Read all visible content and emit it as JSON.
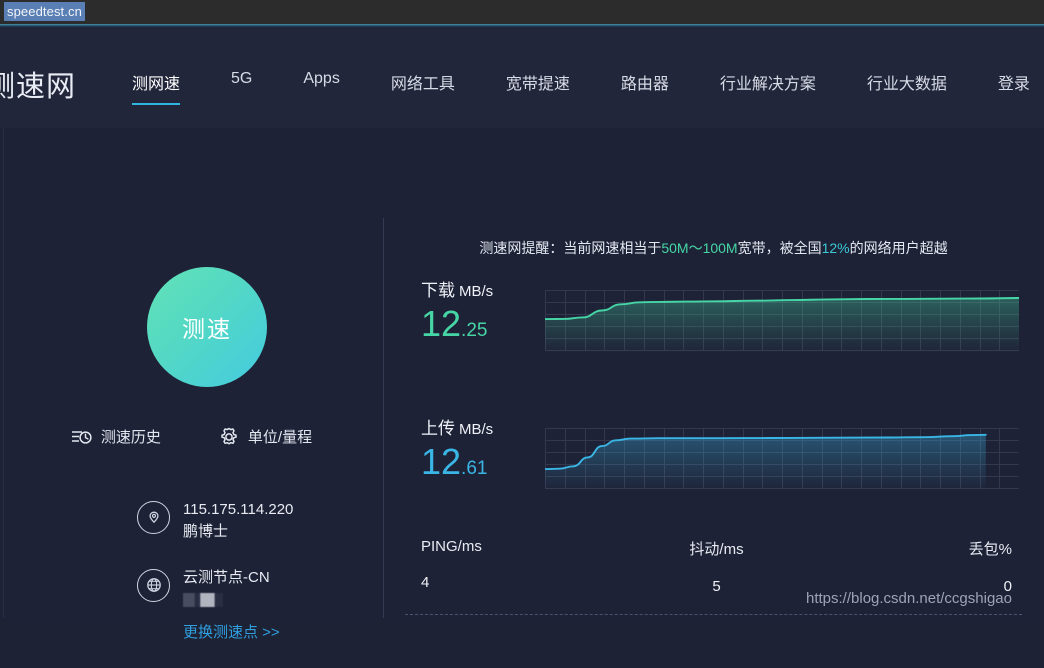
{
  "browser": {
    "url": "speedtest.cn"
  },
  "header": {
    "logo": "测速网",
    "nav": [
      {
        "label": "测网速",
        "active": true
      },
      {
        "label": "5G",
        "active": false
      },
      {
        "label": "Apps",
        "active": false
      },
      {
        "label": "网络工具",
        "active": false
      },
      {
        "label": "宽带提速",
        "active": false
      },
      {
        "label": "路由器",
        "active": false
      },
      {
        "label": "行业解决方案",
        "active": false
      },
      {
        "label": "行业大数据",
        "active": false
      },
      {
        "label": "登录",
        "active": false
      }
    ]
  },
  "left_panel": {
    "start_button_label": "测速",
    "actions": [
      {
        "label": "测速历史",
        "icon": "history-icon"
      },
      {
        "label": "单位/量程",
        "icon": "gear-icon"
      }
    ],
    "ip_info": {
      "icon": "location-pin-icon",
      "ip": "115.175.114.220",
      "isp": "鹏博士"
    },
    "server_info": {
      "icon": "globe-icon",
      "node": "云测节点-CN",
      "detail_masked": "",
      "change_link": "更换测速点 >>"
    }
  },
  "right_panel": {
    "notice": {
      "prefix": "测速网提醒：当前网速相当于",
      "bandwidth": "50M～100M",
      "middle": "宽带，被全国",
      "percent": "12%",
      "suffix": "的网络用户超越"
    },
    "download": {
      "caption": "下载",
      "unit": "MB/s",
      "value_int": "12",
      "value_frac": ".25",
      "color": "#46d6a6"
    },
    "upload": {
      "caption": "上传",
      "unit": "MB/s",
      "value_int": "12",
      "value_frac": ".61",
      "color": "#3ab6e6"
    },
    "stats": [
      {
        "label": "PING/ms",
        "value": "4"
      },
      {
        "label": "抖动/ms",
        "value": "5"
      },
      {
        "label": "丢包%",
        "value": "0"
      }
    ]
  },
  "watermark": "https://blog.csdn.net/ccgshigao",
  "chart_data": [
    {
      "type": "line",
      "name": "download",
      "title": "下载 MB/s",
      "ylabel": "MB/s",
      "xlabel": "",
      "grid": true,
      "color": "#46d6a6",
      "final_value": 12.25,
      "ylim": [
        0,
        14
      ],
      "x": [
        0,
        0.04,
        0.08,
        0.12,
        0.16,
        0.2,
        0.24,
        0.3,
        0.36,
        0.44,
        0.52,
        0.6,
        0.68,
        0.76,
        0.84,
        0.92,
        1.0
      ],
      "values": [
        6.1,
        6.15,
        6.6,
        8.6,
        10.4,
        11.0,
        11.1,
        11.2,
        11.3,
        11.45,
        11.65,
        11.85,
        11.95,
        12.0,
        12.05,
        12.1,
        12.25
      ]
    },
    {
      "type": "line",
      "name": "upload",
      "title": "上传 MB/s",
      "ylabel": "MB/s",
      "xlabel": "",
      "grid": true,
      "color": "#3ab6e6",
      "final_value": 12.61,
      "ylim": [
        0,
        14
      ],
      "x": [
        0,
        0.03,
        0.06,
        0.09,
        0.12,
        0.15,
        0.18,
        0.24,
        0.32,
        0.42,
        0.52,
        0.62,
        0.72,
        0.8,
        0.86,
        0.9,
        0.93
      ],
      "values": [
        2.6,
        2.7,
        3.4,
        6.0,
        9.3,
        11.0,
        11.5,
        11.6,
        11.6,
        11.65,
        11.7,
        11.75,
        11.8,
        11.9,
        12.2,
        12.5,
        12.61
      ]
    }
  ]
}
